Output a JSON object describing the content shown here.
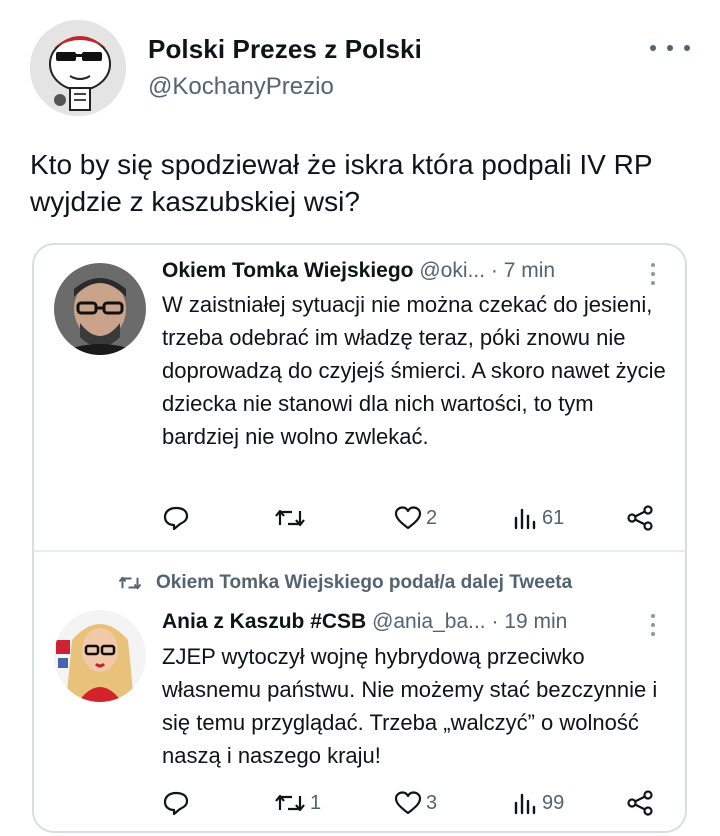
{
  "author": {
    "display_name": "Polski Prezes z Polski",
    "handle": "@KochanyPrezio"
  },
  "tweet": {
    "text": "Kto by się spodziewał że iskra która podpali IV RP wyjdzie z kaszubskiej wsi?"
  },
  "quoted_tweets": [
    {
      "name": "Okiem Tomka Wiejskiego",
      "handle": "@oki...",
      "time": "· 7 min",
      "text": "W zaistniałej sytuacji nie można czekać do jesieni, trzeba odebrać im władzę teraz, póki znowu nie doprowadzą do czyjejś śmierci. A skoro nawet życie dziecka nie stanowi dla nich wartości, to tym bardziej nie wolno zwlekać.",
      "actions": {
        "reply": "",
        "retweet": "",
        "like": "2",
        "views": "61"
      }
    },
    {
      "retweeted_by": "Okiem Tomka Wiejskiego podał/a dalej Tweeta",
      "name": "Ania z Kaszub #CSB",
      "handle": "@ania_ba...",
      "time": "· 19 min",
      "text": "ZJEP wytoczył wojnę hybrydową przeciwko własnemu państwu. Nie możemy stać bezczynnie  i się temu przyglądać. Trzeba „walczyć” o wolność naszą i naszego kraju!",
      "actions": {
        "reply": "",
        "retweet": "1",
        "like": "3",
        "views": "99"
      }
    }
  ],
  "icons": {
    "more": "more-horizontal-icon",
    "reply": "reply-icon",
    "retweet": "retweet-icon",
    "like": "heart-icon",
    "views": "views-icon",
    "share": "share-icon"
  },
  "colors": {
    "text": "#0f1419",
    "secondary": "#536471",
    "border": "#d8dee3"
  }
}
